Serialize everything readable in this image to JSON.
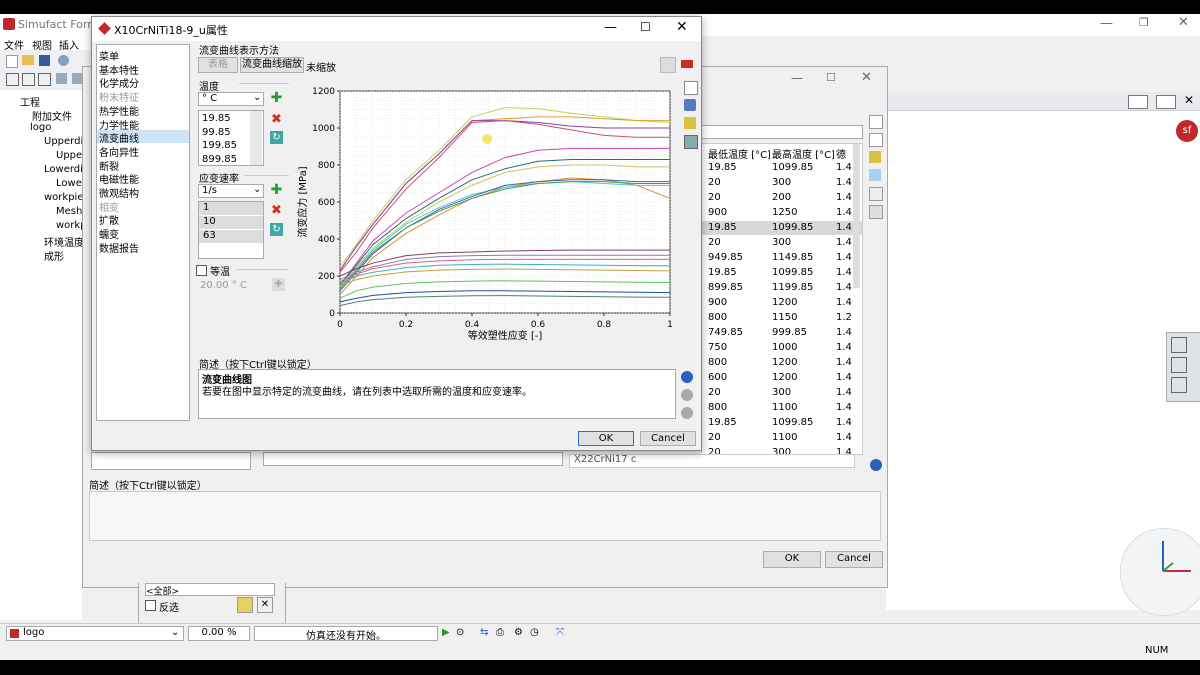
{
  "app": {
    "title": "Simufact Forming",
    "menu": [
      "文件",
      "视图",
      "插入"
    ],
    "tree": [
      {
        "label": "工程",
        "x": 20,
        "y": 94
      },
      {
        "label": "附加文件",
        "x": 32,
        "y": 108
      },
      {
        "label": "logo",
        "x": 30,
        "y": 122
      },
      {
        "label": "Upperdi",
        "x": 44,
        "y": 136
      },
      {
        "label": "Upper",
        "x": 56,
        "y": 150
      },
      {
        "label": "Lowerdi",
        "x": 44,
        "y": 164
      },
      {
        "label": "Lower",
        "x": 56,
        "y": 178
      },
      {
        "label": "workpie",
        "x": 44,
        "y": 192
      },
      {
        "label": "Mesh",
        "x": 56,
        "y": 206
      },
      {
        "label": "workp",
        "x": 56,
        "y": 220
      },
      {
        "label": "环境温度",
        "x": 44,
        "y": 234
      },
      {
        "label": "成形",
        "x": 44,
        "y": 248
      }
    ],
    "status": {
      "model": "logo",
      "progress": "0.00 %",
      "sim_status": "仿真还没有开始。",
      "num": "NUM"
    }
  },
  "back_window": {
    "columns": [
      "最低温度 [°C]",
      "最高温度 [°C]",
      "德"
    ],
    "rows": [
      [
        "19.85",
        "1099.85",
        "1.4"
      ],
      [
        "20",
        "300",
        "1.4"
      ],
      [
        "20",
        "200",
        "1.4"
      ],
      [
        "900",
        "1250",
        "1.4"
      ],
      [
        "19.85",
        "1099.85",
        "1.4"
      ],
      [
        "20",
        "300",
        "1.4"
      ],
      [
        "949.85",
        "1149.85",
        "1.4"
      ],
      [
        "19.85",
        "1099.85",
        "1.4"
      ],
      [
        "899.85",
        "1199.85",
        "1.4"
      ],
      [
        "900",
        "1200",
        "1.4"
      ],
      [
        "800",
        "1150",
        "1.2"
      ],
      [
        "749.85",
        "999.85",
        "1.4"
      ],
      [
        "750",
        "1000",
        "1.4"
      ],
      [
        "800",
        "1200",
        "1.4"
      ],
      [
        "600",
        "1200",
        "1.4"
      ],
      [
        "20",
        "300",
        "1.4"
      ],
      [
        "800",
        "1100",
        "1.4"
      ],
      [
        "19.85",
        "1099.85",
        "1.4"
      ],
      [
        "20",
        "1100",
        "1.4"
      ],
      [
        "20",
        "300",
        "1.4"
      ]
    ],
    "bottom_item": "X22CrNi17 c",
    "desc_label": "简述（按下Ctrl键以锁定）",
    "ok": "OK",
    "cancel": "Cancel",
    "filter": "<全部>",
    "invert": "反选"
  },
  "dialog": {
    "title": "X10CrNiTi18-9_u属性",
    "sidebar": [
      {
        "label": "菜单",
        "disabled": false,
        "selected": false
      },
      {
        "label": "基本特性",
        "disabled": false,
        "selected": false
      },
      {
        "label": "化学成分",
        "disabled": false,
        "selected": false
      },
      {
        "label": "粉末特征",
        "disabled": true,
        "selected": false
      },
      {
        "label": "热学性能",
        "disabled": false,
        "selected": false
      },
      {
        "label": "力学性能",
        "disabled": false,
        "selected": false
      },
      {
        "label": "流变曲线",
        "disabled": false,
        "selected": true
      },
      {
        "label": "各向异性",
        "disabled": false,
        "selected": false
      },
      {
        "label": "断裂",
        "disabled": false,
        "selected": false
      },
      {
        "label": "电磁性能",
        "disabled": false,
        "selected": false
      },
      {
        "label": "微观结构",
        "disabled": false,
        "selected": false
      },
      {
        "label": "相变",
        "disabled": true,
        "selected": false
      },
      {
        "label": "扩散",
        "disabled": false,
        "selected": false
      },
      {
        "label": "蠕变",
        "disabled": false,
        "selected": false
      },
      {
        "label": "数据报告",
        "disabled": false,
        "selected": false
      }
    ],
    "method_label": "流变曲线表示方法",
    "table_btn": "表格",
    "scale_btn": "流变曲线缩放",
    "scale_value": "未缩放",
    "temp_label": "温度",
    "temp_unit": "° C",
    "temps": [
      "19.85",
      "99.85",
      "199.85",
      "899.85"
    ],
    "rate_label": "应变速率",
    "rate_unit": "1/s",
    "rates": [
      "1",
      "10",
      "63"
    ],
    "isothermal_label": "等温",
    "isothermal_value": "20.00 ° C",
    "desc_label": "简述（按下Ctrl键以锁定）",
    "desc_title": "流变曲线图",
    "desc_text": "若要在图中显示特定的流变曲线，请在列表中选取所需的温度和应变速率。",
    "ok": "OK",
    "cancel": "Cancel"
  },
  "chart_data": {
    "type": "line",
    "xlabel": "等效塑性应变 [-]",
    "ylabel": "流变应力 [MPa]",
    "xlim": [
      0,
      1
    ],
    "ylim": [
      0,
      1200
    ],
    "xticks": [
      0,
      0.2,
      0.4,
      0.6,
      0.8,
      1
    ],
    "yticks": [
      0,
      200,
      400,
      600,
      800,
      1000,
      1200
    ],
    "grid": true,
    "x": [
      0,
      0.05,
      0.1,
      0.2,
      0.3,
      0.4,
      0.5,
      0.6,
      0.7,
      0.8,
      0.9,
      1.0
    ],
    "series": [
      {
        "color": "#bcd35a",
        "values": [
          250,
          370,
          500,
          720,
          880,
          1060,
          1110,
          1105,
          1080,
          1060,
          1040,
          1030
        ]
      },
      {
        "color": "#e0a020",
        "values": [
          230,
          360,
          480,
          700,
          860,
          1040,
          1050,
          1060,
          1060,
          1050,
          1040,
          1040
        ]
      },
      {
        "color": "#9040a0",
        "values": [
          230,
          360,
          480,
          700,
          860,
          1040,
          1040,
          1030,
          1010,
          1000,
          1000,
          1000
        ]
      },
      {
        "color": "#c85070",
        "values": [
          220,
          330,
          460,
          670,
          840,
          1030,
          1040,
          1020,
          990,
          960,
          950,
          950
        ]
      },
      {
        "color": "#d040c0",
        "values": [
          150,
          270,
          390,
          540,
          650,
          760,
          840,
          880,
          890,
          890,
          890,
          890
        ]
      },
      {
        "color": "#207070",
        "values": [
          150,
          260,
          370,
          510,
          620,
          720,
          780,
          820,
          830,
          830,
          830,
          830
        ]
      },
      {
        "color": "#d0c060",
        "values": [
          140,
          250,
          350,
          490,
          600,
          690,
          760,
          790,
          800,
          800,
          790,
          790
        ]
      },
      {
        "color": "#e09030",
        "values": [
          100,
          200,
          300,
          430,
          530,
          620,
          680,
          710,
          730,
          720,
          690,
          620
        ]
      },
      {
        "color": "#50c8d0",
        "values": [
          130,
          240,
          340,
          480,
          570,
          640,
          680,
          700,
          710,
          700,
          690,
          690
        ]
      },
      {
        "color": "#4060c0",
        "values": [
          120,
          220,
          320,
          460,
          560,
          630,
          690,
          710,
          720,
          720,
          710,
          710
        ]
      },
      {
        "color": "#40a050",
        "values": [
          130,
          230,
          330,
          460,
          550,
          620,
          670,
          700,
          710,
          710,
          700,
          700
        ]
      },
      {
        "color": "#804060",
        "values": [
          200,
          240,
          270,
          310,
          325,
          330,
          335,
          338,
          340,
          340,
          340,
          340
        ]
      },
      {
        "color": "#8080c0",
        "values": [
          180,
          220,
          250,
          290,
          305,
          310,
          312,
          312,
          312,
          312,
          312,
          312
        ]
      },
      {
        "color": "#e06080",
        "values": [
          170,
          210,
          240,
          270,
          282,
          288,
          290,
          290,
          290,
          290,
          290,
          290
        ]
      },
      {
        "color": "#40b0c0",
        "values": [
          160,
          200,
          220,
          245,
          258,
          262,
          264,
          262,
          260,
          258,
          256,
          255
        ]
      },
      {
        "color": "#c0a040",
        "values": [
          150,
          180,
          200,
          222,
          232,
          236,
          238,
          236,
          234,
          232,
          230,
          228
        ]
      },
      {
        "color": "#60c060",
        "values": [
          80,
          120,
          140,
          160,
          168,
          172,
          174,
          172,
          170,
          168,
          166,
          165
        ]
      },
      {
        "color": "#2050a0",
        "values": [
          60,
          80,
          95,
          110,
          116,
          120,
          120,
          118,
          116,
          114,
          112,
          110
        ]
      },
      {
        "color": "#508070",
        "values": [
          40,
          60,
          72,
          85,
          90,
          93,
          94,
          92,
          90,
          88,
          86,
          85
        ]
      }
    ]
  }
}
